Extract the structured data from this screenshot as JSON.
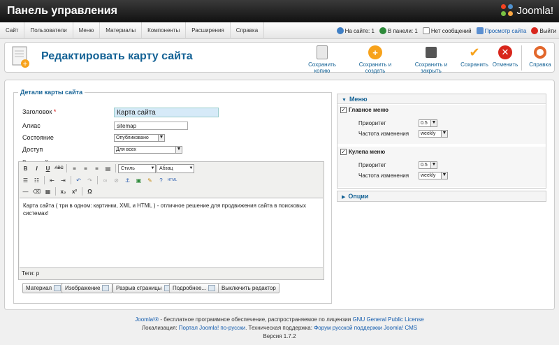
{
  "header": {
    "title": "Панель управления",
    "logo_text": "Joomla!"
  },
  "menu": {
    "items": [
      "Сайт",
      "Пользователи",
      "Меню",
      "Материалы",
      "Компоненты",
      "Расширения",
      "Справка"
    ],
    "status": {
      "on_site": "На сайте: 1",
      "in_panel": "В панели: 1",
      "messages": "Нет сообщений",
      "view_site": "Просмотр сайта",
      "logout": "Выйти"
    }
  },
  "toolbar": {
    "page_title": "Редактировать карту сайта",
    "buttons": {
      "save_copy": "Сохранить копию",
      "save_new": "Сохранить и создать",
      "save_close": "Сохранить и закрыть",
      "save": "Сохранить",
      "cancel": "Отменить",
      "help": "Справка"
    }
  },
  "details": {
    "legend": "Детали карты сайта",
    "title_label": "Заголовок",
    "title_required": "*",
    "title_value": "Карта сайта",
    "alias_label": "Алиас",
    "alias_value": "sitemap",
    "state_label": "Состояние",
    "state_value": "Опубликовано",
    "access_label": "Доступ",
    "access_value": "Для всех",
    "intro_label": "Вводный текст"
  },
  "editor": {
    "style_select": "Стиль",
    "format_select": "Абзац",
    "content": "Карта сайта ( три в одном: картинки, XML и HTML ) - отличное решение для продвижения сайта в поисковых системах!",
    "path": "Теги: p",
    "buttons": {
      "article": "Материал",
      "image": "Изображение",
      "pagebreak": "Разрыв страницы",
      "readmore": "Подробнее...",
      "toggle": "Выключить редактор"
    }
  },
  "menu_panel": {
    "title": "Меню",
    "menus": [
      {
        "name": "Главное меню",
        "priority_label": "Приоритет",
        "priority": "0.5",
        "freq_label": "Частота изменения",
        "freq": "weekly"
      },
      {
        "name": "Кулепа меню",
        "priority_label": "Приоритет",
        "priority": "0.5",
        "freq_label": "Частота изменения",
        "freq": "weekly"
      }
    ]
  },
  "options_panel": {
    "title": "Опции"
  },
  "footer": {
    "line1_a": "Joomla!®",
    "line1_b": " - бесплатное программное обеспечение, распространяемое по лицензии ",
    "line1_link": "GNU General Public License",
    "line2_a": "Локализация: ",
    "line2_link1": "Портал Joomla! по-русски",
    "line2_b": ". Техническая поддержка: ",
    "line2_link2": "Форум русской поддержки Joomla! CMS",
    "line3": "Версия 1.7.2"
  },
  "colors": {
    "accent": "#146295",
    "link": "#135cae",
    "header_bg": "#1a1a1a",
    "title_field_bg": "#d6eaf8"
  }
}
